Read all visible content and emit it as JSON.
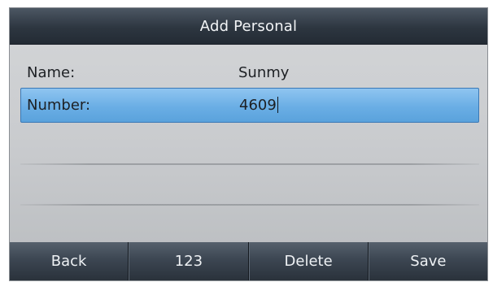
{
  "header": {
    "title": "Add Personal"
  },
  "form": {
    "name_label": "Name:",
    "name_value": "Sunmy",
    "number_label": "Number:",
    "number_value": "4609"
  },
  "softkeys": [
    "Back",
    "123",
    "Delete",
    "Save"
  ],
  "colors": {
    "titlebar": "#2d3640",
    "selected_row": "#6aaee5",
    "softkey_bg": "#3c4652",
    "screen_bg": "#c9cbce"
  }
}
